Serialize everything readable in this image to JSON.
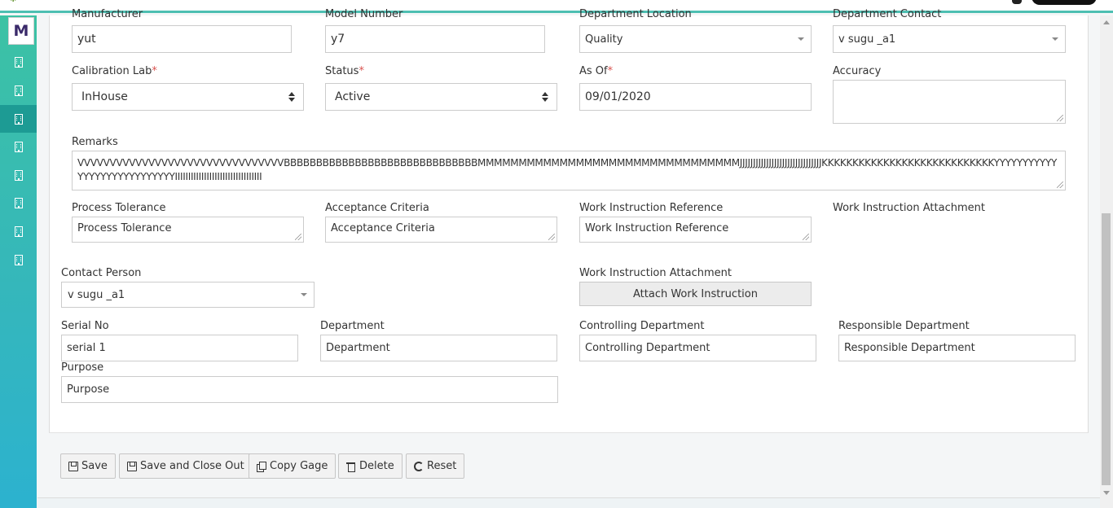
{
  "sidebar": {
    "logo": "M",
    "items": [
      {
        "icon": "building-icon",
        "active": false
      },
      {
        "icon": "building-icon",
        "active": false
      },
      {
        "icon": "building-icon",
        "active": true
      },
      {
        "icon": "building-icon",
        "active": false
      },
      {
        "icon": "building-icon",
        "active": false
      },
      {
        "icon": "building-icon",
        "active": false
      },
      {
        "icon": "building-icon",
        "active": false
      },
      {
        "icon": "building-icon",
        "active": false
      }
    ]
  },
  "form": {
    "manufacturer": {
      "label": "Manufacturer",
      "value": "yut"
    },
    "model_number": {
      "label": "Model Number",
      "value": "y7"
    },
    "department_location": {
      "label": "Department Location",
      "value": "Quality"
    },
    "department_contact": {
      "label": "Department Contact",
      "value": "v sugu _a1"
    },
    "calibration_lab": {
      "label": "Calibration Lab",
      "required": "*",
      "value": "InHouse"
    },
    "status": {
      "label": "Status",
      "required": "*",
      "value": "Active"
    },
    "as_of": {
      "label": "As Of",
      "required": "*",
      "value": "09/01/2020"
    },
    "accuracy": {
      "label": "Accuracy",
      "value": ""
    },
    "remarks": {
      "label": "Remarks",
      "value": "VVVVVVVVVVVVVVVVVVVVVVVVVVVVVVVVBBBBBBBBBBBBBBBBBBBBBBBBBBBBBBMMMMMMMMMMMMMMMMMMMMMMMMMMMMMMMMJJJJJJJJJJJJJJJJJJJJJJJJJJJJJJJKKKKKKKKKKKKKKKKKKKKKKKKKKKKYYYYYYYYYYYYYYYYYYYYYYYYYYYYIIIIIIIIIIIIIIIIIIIIIIIIIIIIIIIII"
    },
    "process_tolerance": {
      "label": "Process Tolerance",
      "placeholder": "Process Tolerance"
    },
    "acceptance_criteria": {
      "label": "Acceptance Criteria",
      "placeholder": "Acceptance Criteria"
    },
    "work_instruction_reference": {
      "label": "Work Instruction Reference",
      "placeholder": "Work Instruction Reference"
    },
    "work_instruction_attachment_top": {
      "label": "Work Instruction Attachment"
    },
    "contact_person": {
      "label": "Contact Person",
      "value": "v sugu _a1"
    },
    "work_instruction_attachment": {
      "label": "Work Instruction Attachment",
      "button": "Attach Work Instruction"
    },
    "serial_no": {
      "label": "Serial No",
      "value": "serial 1"
    },
    "department": {
      "label": "Department",
      "placeholder": "Department"
    },
    "controlling_department": {
      "label": "Controlling Department",
      "placeholder": "Controlling Department"
    },
    "responsible_department": {
      "label": "Responsible Department",
      "placeholder": "Responsible Department"
    },
    "purpose": {
      "label": "Purpose",
      "placeholder": "Purpose"
    }
  },
  "toolbar": {
    "save": "Save",
    "save_close": "Save and Close Out",
    "copy": "Copy Gage",
    "delete": "Delete",
    "reset": "Reset"
  },
  "colors": {
    "accent": "#4dbfb2",
    "sidebar_top": "#3cc2a4",
    "sidebar_bottom": "#2cb2cf",
    "required": "#d9534f"
  }
}
